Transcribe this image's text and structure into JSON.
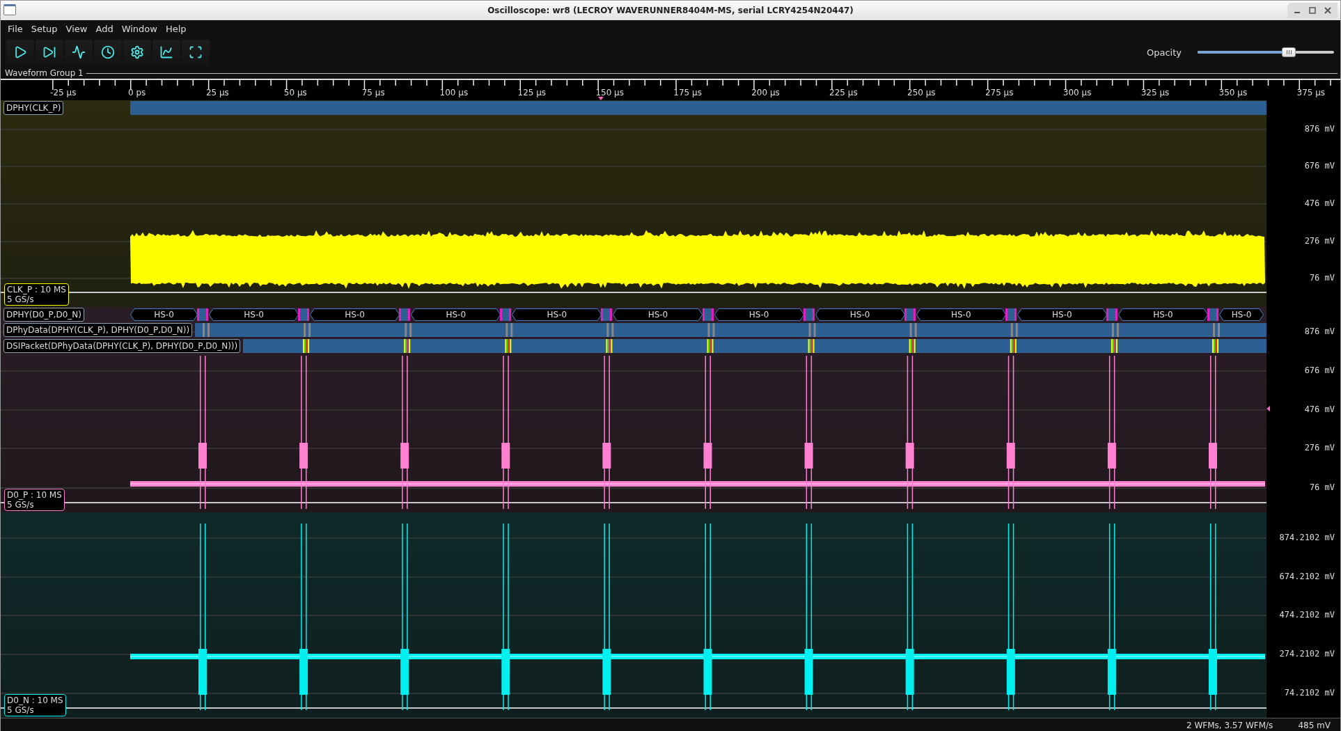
{
  "window": {
    "title": "Oscilloscope: wr8 (LECROY WAVERUNNER8404M-MS, serial LCRY4254N20447)"
  },
  "menu": [
    "File",
    "Setup",
    "View",
    "Add",
    "Window",
    "Help"
  ],
  "opacity": {
    "label": "Opacity",
    "level": 0.67
  },
  "group": {
    "title": "Waveform Group 1"
  },
  "ruler": {
    "ticks": [
      "-25 µs",
      "0 ps",
      "25 µs",
      "50 µs",
      "75 µs",
      "100 µs",
      "125 µs",
      "150 µs",
      "175 µs",
      "200 µs",
      "225 µs",
      "250 µs",
      "275 µs",
      "300 µs",
      "325 µs",
      "350 µs",
      "375 µs"
    ]
  },
  "panels": [
    {
      "rows": [
        {
          "kind": "bus",
          "label": "DPHY(CLK_P)"
        }
      ],
      "channel": {
        "name": "CLK_P : 10 MS",
        "rate": "5 GS/s",
        "color": "#ffff00"
      },
      "axis": [
        "876 mV",
        "676 mV",
        "476 mV",
        "276 mV",
        "76 mV"
      ]
    },
    {
      "rows": [
        {
          "kind": "states",
          "label": "DPHY(D0_P,D0_N)",
          "segments": [
            "HS-0",
            "HS-0",
            "HS-0",
            "HS-0",
            "HS-0",
            "HS-0",
            "HS-0",
            "HS-0",
            "HS-0",
            "HS-0",
            "HS-0",
            "HS-0"
          ]
        },
        {
          "kind": "data",
          "label": "DPhyData(DPHY(CLK_P), DPHY(D0_P,D0_N))"
        },
        {
          "kind": "packet",
          "label": "DSIPacket(DPhyData(DPHY(CLK_P), DPHY(D0_P,D0_N)))"
        }
      ],
      "channel": {
        "name": "D0_P : 10 MS",
        "rate": "5 GS/s",
        "color": "#ff80d0"
      },
      "axis": [
        "876 mV",
        "676 mV",
        "476 mV",
        "276 mV",
        "76 mV"
      ]
    },
    {
      "channel": {
        "name": "D0_N : 10 MS",
        "rate": "5 GS/s",
        "color": "#00f0f0"
      },
      "axis": [
        "874.2102 mV",
        "674.2102 mV",
        "474.2102 mV",
        "274.2102 mV",
        "74.2102 mV"
      ]
    }
  ],
  "status": {
    "info": "2 WFMs, 3.57 WFM/s",
    "reading": "485 mV"
  }
}
